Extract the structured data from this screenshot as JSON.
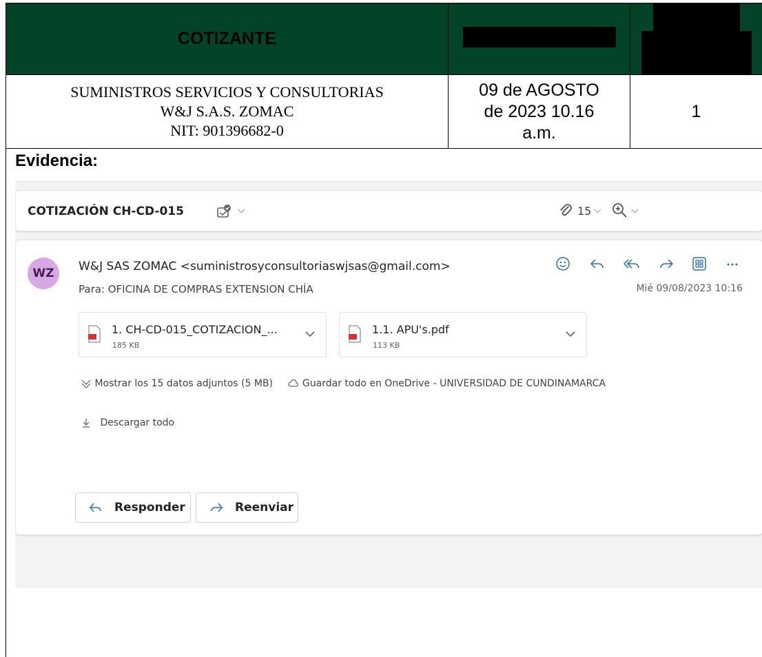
{
  "doc_header": {
    "col1_header": "COTIZANTE",
    "company": {
      "line1": "SUMINISTROS SERVICIOS Y CONSULTORIAS",
      "line2": "W&J S.A.S. ZOMAC",
      "line3": "NIT: 901396682-0"
    },
    "date": {
      "line1": "09 de AGOSTO",
      "line2": "de 2023 10.16",
      "line3": "a.m."
    },
    "number": "1",
    "header_bg": "#034428"
  },
  "evidence_label": "Evidencia:",
  "email": {
    "subject": "COTIZACIÓN CH-CD-015",
    "attachment_count": "15",
    "sender_initials": "WZ",
    "sender": "W&J SAS ZOMAC <suministrosyconsultoriaswjsas@gmail.com>",
    "recipient": "Para: OFICINA DE COMPRAS EXTENSION CHÍA",
    "date": "Mié 09/08/2023 10:16",
    "attachments": [
      {
        "name": "1. CH-CD-015_COTIZACION_...",
        "size": "185 KB"
      },
      {
        "name": "1.1. APU's.pdf",
        "size": "113 KB"
      }
    ],
    "show_all": "Mostrar los 15 datos adjuntos (5 MB)",
    "save_onedrive": "Guardar todo en OneDrive - UNIVERSIDAD DE CUNDINAMARCA",
    "download_all": "Descargar todo",
    "reply_button": "Responder",
    "forward_button": "Reenviar",
    "avatar_color": "#d8a8e2",
    "accent_color": "#2b6cb0"
  }
}
